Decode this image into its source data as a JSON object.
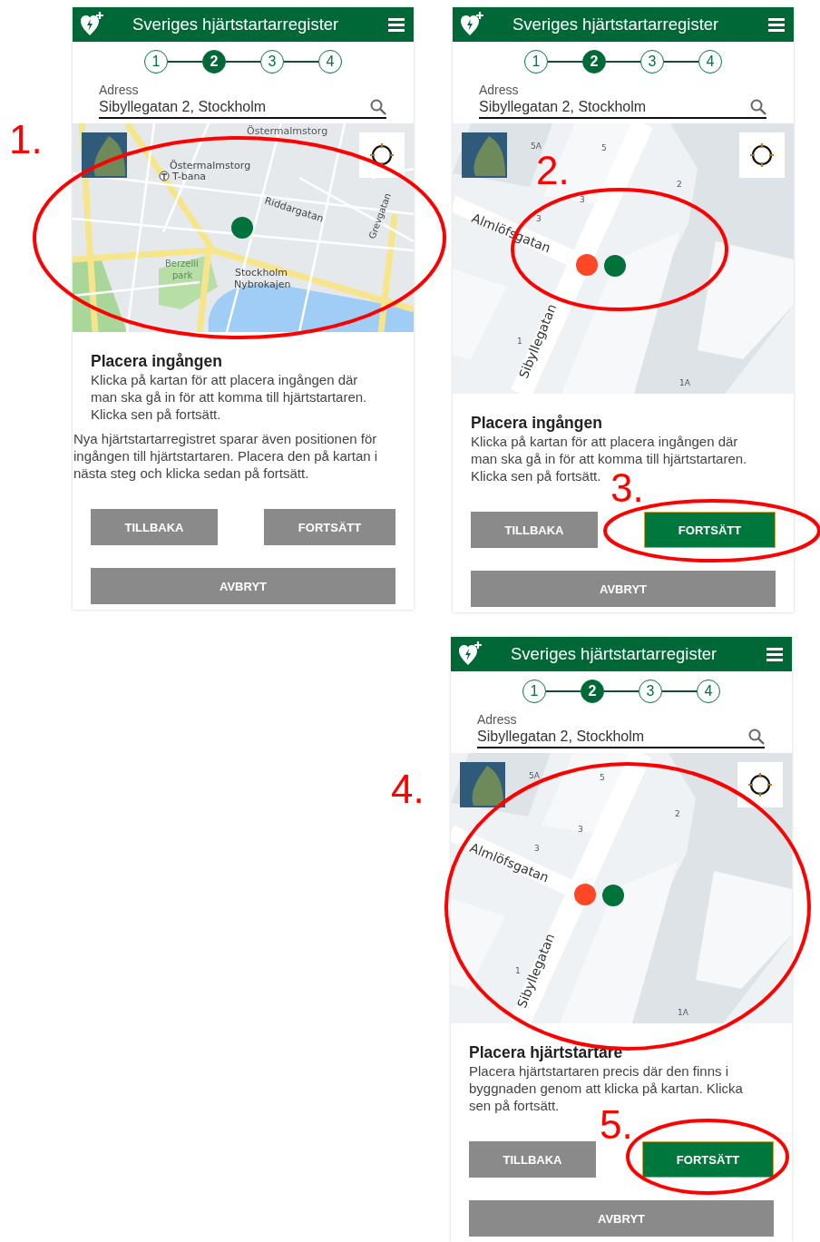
{
  "panels": [
    {
      "header": {
        "title": "Sveriges hjärtstartarregister"
      },
      "steps": [
        {
          "label": "1",
          "selected": false
        },
        {
          "label": "2",
          "selected": true
        },
        {
          "label": "3",
          "selected": false
        },
        {
          "label": "4",
          "selected": false
        }
      ],
      "address": {
        "label": "Adress",
        "value": "Sibyllegatan 2, Stockholm"
      },
      "map": {
        "kind": "city",
        "labels": [
          "Östermalmstorg",
          "Östermalmstorg",
          "T-bana",
          "Riddargatan",
          "Grevgatan",
          "Berzelii",
          "park",
          "Stockholm",
          "Nybrokajen"
        ],
        "markers": [
          {
            "color": "#00723a"
          }
        ]
      },
      "heading": "Placera ingången",
      "description": "Klicka på kartan för att placera ingången där man ska gå in för att komma till hjärtstartaren. Klicka sen på fortsätt.",
      "note": "Nya hjärtstartarregistret sparar även positionen för ingången till hjärtstartaren. Placera den på kartan i nästa steg och klicka sedan på fortsätt.",
      "buttons": [
        {
          "label": "TILLBAKA",
          "primary": false
        },
        {
          "label": "FORTSÄTT",
          "primary": false
        }
      ],
      "cancel": "AVBRYT",
      "annotations": [
        {
          "label": "1."
        }
      ]
    },
    {
      "header": {
        "title": "Sveriges hjärtstartarregister"
      },
      "steps": [
        {
          "label": "1",
          "selected": false
        },
        {
          "label": "2",
          "selected": true
        },
        {
          "label": "3",
          "selected": false
        },
        {
          "label": "4",
          "selected": false
        }
      ],
      "address": {
        "label": "Adress",
        "value": "Sibyllegatan 2, Stockholm"
      },
      "map": {
        "kind": "street",
        "labels": [
          "5A",
          "5",
          "3",
          "3",
          "2",
          "1",
          "1A",
          "Almlöfsgatan",
          "Sibyllegatan"
        ],
        "markers": [
          {
            "color": "#ff4726"
          },
          {
            "color": "#00723a"
          }
        ]
      },
      "heading": "Placera ingången",
      "description": "Klicka på kartan för att placera ingången där man ska gå in för att komma till hjärtstartaren. Klicka sen på fortsätt.",
      "buttons": [
        {
          "label": "TILLBAKA",
          "primary": false
        },
        {
          "label": "FORTSÄTT",
          "primary": true
        }
      ],
      "cancel": "AVBRYT",
      "annotations": [
        {
          "label": "2."
        },
        {
          "label": "3."
        }
      ]
    },
    {
      "header": {
        "title": "Sveriges hjärtstartarregister"
      },
      "steps": [
        {
          "label": "1",
          "selected": false
        },
        {
          "label": "2",
          "selected": true
        },
        {
          "label": "3",
          "selected": false
        },
        {
          "label": "4",
          "selected": false
        }
      ],
      "address": {
        "label": "Adress",
        "value": "Sibyllegatan 2, Stockholm"
      },
      "map": {
        "kind": "street",
        "labels": [
          "5A",
          "5",
          "3",
          "3",
          "2",
          "1",
          "1A",
          "Almlöfsgatan",
          "Sibyllegatan"
        ],
        "markers": [
          {
            "color": "#ff4726"
          },
          {
            "color": "#00723a"
          }
        ]
      },
      "heading": "Placera hjärtstartare",
      "description": "Placera hjärtstartaren precis där den finns i byggnaden genom att klicka på kartan. Klicka sen på fortsätt.",
      "buttons": [
        {
          "label": "TILLBAKA",
          "primary": false
        },
        {
          "label": "FORTSÄTT",
          "primary": true
        }
      ],
      "cancel": "AVBRYT",
      "annotations": [
        {
          "label": "4."
        },
        {
          "label": "5."
        }
      ]
    }
  ]
}
